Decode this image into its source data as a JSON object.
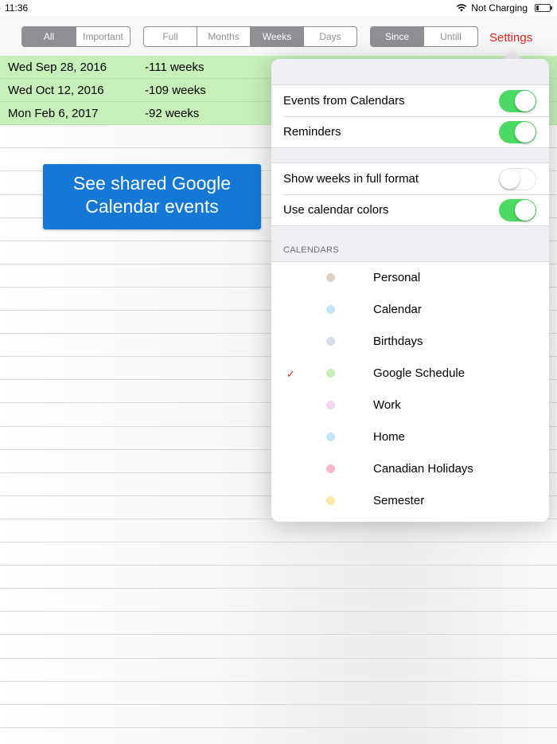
{
  "status_bar": {
    "time": "11:36",
    "charging": "Not Charging"
  },
  "toolbar": {
    "filter_segments": [
      {
        "label": "All",
        "active": true
      },
      {
        "label": "Important",
        "active": false
      }
    ],
    "format_segments": [
      {
        "label": "Full",
        "active": false
      },
      {
        "label": "Months",
        "active": false
      },
      {
        "label": "Weeks",
        "active": true
      },
      {
        "label": "Days",
        "active": false
      }
    ],
    "direction_segments": [
      {
        "label": "Since",
        "active": true
      },
      {
        "label": "Untill",
        "active": false
      }
    ],
    "settings_label": "Settings"
  },
  "events": [
    {
      "date": "Wed Sep 28, 2016",
      "weeks": "-111 weeks"
    },
    {
      "date": "Wed Oct 12, 2016",
      "weeks": "-109 weeks"
    },
    {
      "date": "Mon Feb 6, 2017",
      "weeks": "-92 weeks"
    }
  ],
  "callout": {
    "line1": "See shared Google",
    "line2": "Calendar events"
  },
  "settings": {
    "sources": [
      {
        "label": "Events from Calendars",
        "on": true
      },
      {
        "label": "Reminders",
        "on": true
      }
    ],
    "display": [
      {
        "label": "Show weeks in full format",
        "on": false
      },
      {
        "label": "Use calendar colors",
        "on": true
      }
    ],
    "calendars_header": "CALENDARS",
    "calendars": [
      {
        "name": "Personal",
        "color": "#ddd1c4",
        "checked": false
      },
      {
        "name": "Calendar",
        "color": "#bfe5f6",
        "checked": false
      },
      {
        "name": "Birthdays",
        "color": "#d6dde6",
        "checked": false
      },
      {
        "name": "Google Schedule",
        "color": "#c6efba",
        "checked": true
      },
      {
        "name": "Work",
        "color": "#f1d6f1",
        "checked": false
      },
      {
        "name": "Home",
        "color": "#bfe5f6",
        "checked": false
      },
      {
        "name": "Canadian Holidays",
        "color": "#f7b8c8",
        "checked": false
      },
      {
        "name": "Semester",
        "color": "#fbe9a5",
        "checked": false
      }
    ],
    "check_glyph": "✓"
  }
}
